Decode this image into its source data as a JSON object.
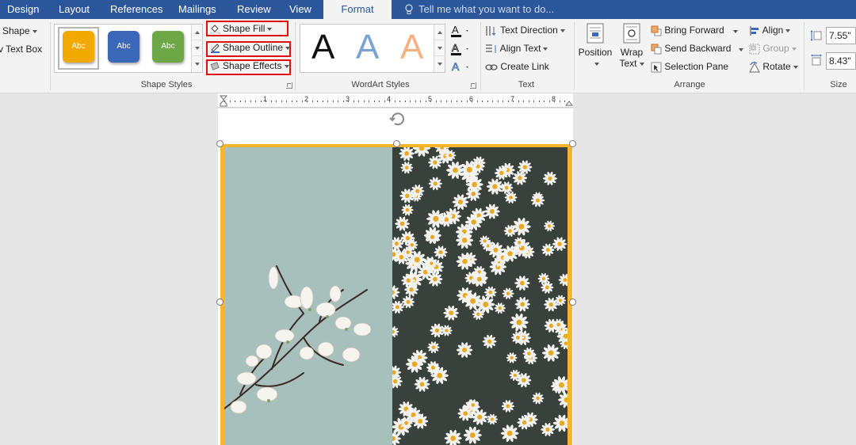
{
  "tabs": [
    {
      "label": "Design"
    },
    {
      "label": "Layout"
    },
    {
      "label": "References"
    },
    {
      "label": "Mailings"
    },
    {
      "label": "Review"
    },
    {
      "label": "View"
    },
    {
      "label": "Format"
    }
  ],
  "tell_me": "Tell me what you want to do...",
  "insert_shapes": {
    "shape_label": "Shape",
    "text_box_label": "v Text Box"
  },
  "shape_styles": {
    "group_label": "Shape Styles",
    "swatches": [
      {
        "label": "Abc",
        "color": "#f2a900"
      },
      {
        "label": "Abc",
        "color": "#3a67b8"
      },
      {
        "label": "Abc",
        "color": "#6ea846"
      }
    ],
    "fill_label": "Shape Fill",
    "outline_label": "Shape Outline",
    "effects_label": "Shape Effects"
  },
  "wordart": {
    "group_label": "WordArt Styles",
    "letters": [
      {
        "char": "A",
        "color": "#111111"
      },
      {
        "char": "A",
        "color": "#7aa3d6"
      },
      {
        "char": "A",
        "color": "#f4b183"
      }
    ]
  },
  "text_group": {
    "group_label": "Text",
    "direction_label": "Text Direction",
    "align_label": "Align Text",
    "link_label": "Create Link"
  },
  "arrange": {
    "group_label": "Arrange",
    "position_label": "Position",
    "wrap_line1": "Wrap",
    "wrap_line2": "Text",
    "bring_forward": "Bring Forward",
    "send_backward": "Send Backward",
    "selection_pane": "Selection Pane",
    "align": "Align",
    "group": "Group",
    "rotate": "Rotate"
  },
  "size": {
    "group_label": "Size",
    "height_value": "7.55\"",
    "width_value": "8.43\""
  },
  "ruler_numbers": [
    "1",
    "2",
    "3",
    "4",
    "5",
    "6",
    "7",
    "8"
  ]
}
